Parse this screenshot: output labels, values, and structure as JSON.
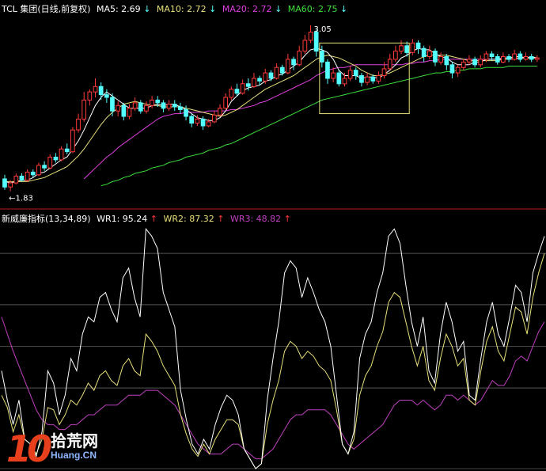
{
  "header_top": {
    "stock": "TCL 集团(日线,前复权)",
    "ma5": "MA5: 2.69",
    "ma10": "MA10: 2.72",
    "ma20": "MA20: 2.72",
    "ma60": "MA60: 2.75",
    "arrow_down": "↓"
  },
  "header_bottom": {
    "indicator": "新威廉指标(13,34,89)",
    "wr1": "WR1: 95.24",
    "wr2": "WR2: 87.32",
    "wr3": "WR3: 48.82",
    "arrow_up": "↑"
  },
  "colors": {
    "up": "#ff3a3a",
    "down": "#54ffff",
    "ma5": "#ffffff",
    "ma10": "#e8e07a",
    "ma20": "#e040e0",
    "ma60": "#3ee03e",
    "box": "#e8e07a",
    "grid": "#8a8a8a",
    "divider": "#b02020",
    "wr1": "#ffffff",
    "wr2": "#e8e07a",
    "wr3": "#c040c0"
  },
  "watermark": {
    "num": "10",
    "cn": "拾荒网",
    "url": "Huang.CN"
  },
  "chart_data": [
    {
      "type": "candlestick",
      "high_label": "3.05",
      "low_label": "1.83",
      "low_arrow": "←",
      "y_range": [
        1.78,
        3.12
      ],
      "candles": [
        [
          1.92,
          1.86,
          1.95,
          1.84
        ],
        [
          1.86,
          1.89,
          1.91,
          1.83
        ],
        [
          1.89,
          1.94,
          1.96,
          1.88
        ],
        [
          1.94,
          1.91,
          1.96,
          1.9
        ],
        [
          1.91,
          1.97,
          1.99,
          1.9
        ],
        [
          1.97,
          1.95,
          1.99,
          1.93
        ],
        [
          1.95,
          2.02,
          2.04,
          1.94
        ],
        [
          2.02,
          2.0,
          2.05,
          1.98
        ],
        [
          2.0,
          2.08,
          2.1,
          1.99
        ],
        [
          2.08,
          2.06,
          2.11,
          2.04
        ],
        [
          2.06,
          2.14,
          2.16,
          2.05
        ],
        [
          2.14,
          2.12,
          2.18,
          2.1
        ],
        [
          2.12,
          2.28,
          2.3,
          2.11
        ],
        [
          2.28,
          2.36,
          2.4,
          2.26
        ],
        [
          2.36,
          2.5,
          2.56,
          2.34
        ],
        [
          2.5,
          2.56,
          2.58,
          2.46
        ],
        [
          2.56,
          2.6,
          2.66,
          2.52
        ],
        [
          2.6,
          2.54,
          2.63,
          2.5
        ],
        [
          2.54,
          2.52,
          2.58,
          2.48
        ],
        [
          2.52,
          2.42,
          2.55,
          2.38
        ],
        [
          2.42,
          2.46,
          2.49,
          2.38
        ],
        [
          2.46,
          2.38,
          2.48,
          2.35
        ],
        [
          2.38,
          2.44,
          2.47,
          2.36
        ],
        [
          2.44,
          2.48,
          2.52,
          2.42
        ],
        [
          2.48,
          2.42,
          2.5,
          2.4
        ],
        [
          2.42,
          2.46,
          2.49,
          2.4
        ],
        [
          2.46,
          2.5,
          2.53,
          2.44
        ],
        [
          2.5,
          2.48,
          2.53,
          2.45
        ],
        [
          2.48,
          2.44,
          2.5,
          2.41
        ],
        [
          2.44,
          2.47,
          2.5,
          2.42
        ],
        [
          2.47,
          2.45,
          2.5,
          2.42
        ],
        [
          2.45,
          2.43,
          2.48,
          2.4
        ],
        [
          2.43,
          2.38,
          2.46,
          2.35
        ],
        [
          2.38,
          2.33,
          2.4,
          2.3
        ],
        [
          2.33,
          2.36,
          2.39,
          2.31
        ],
        [
          2.36,
          2.31,
          2.38,
          2.28
        ],
        [
          2.31,
          2.34,
          2.36,
          2.3
        ],
        [
          2.34,
          2.39,
          2.42,
          2.33
        ],
        [
          2.39,
          2.44,
          2.47,
          2.38
        ],
        [
          2.44,
          2.52,
          2.55,
          2.43
        ],
        [
          2.52,
          2.58,
          2.6,
          2.5
        ],
        [
          2.58,
          2.55,
          2.62,
          2.53
        ],
        [
          2.55,
          2.62,
          2.65,
          2.54
        ],
        [
          2.62,
          2.6,
          2.66,
          2.57
        ],
        [
          2.6,
          2.66,
          2.7,
          2.59
        ],
        [
          2.66,
          2.64,
          2.68,
          2.61
        ],
        [
          2.64,
          2.7,
          2.73,
          2.62
        ],
        [
          2.7,
          2.66,
          2.72,
          2.64
        ],
        [
          2.66,
          2.74,
          2.77,
          2.65
        ],
        [
          2.74,
          2.7,
          2.76,
          2.68
        ],
        [
          2.7,
          2.8,
          2.84,
          2.69
        ],
        [
          2.8,
          2.76,
          2.82,
          2.72
        ],
        [
          2.76,
          2.86,
          2.9,
          2.75
        ],
        [
          2.86,
          2.94,
          2.98,
          2.84
        ],
        [
          2.94,
          3.0,
          3.05,
          2.92
        ],
        [
          3.0,
          2.86,
          3.02,
          2.82
        ],
        [
          2.86,
          2.78,
          2.9,
          2.74
        ],
        [
          2.78,
          2.66,
          2.8,
          2.62
        ],
        [
          2.66,
          2.7,
          2.74,
          2.63
        ],
        [
          2.7,
          2.62,
          2.72,
          2.6
        ],
        [
          2.62,
          2.66,
          2.7,
          2.6
        ],
        [
          2.66,
          2.72,
          2.75,
          2.64
        ],
        [
          2.72,
          2.68,
          2.74,
          2.65
        ],
        [
          2.68,
          2.63,
          2.7,
          2.6
        ],
        [
          2.63,
          2.67,
          2.7,
          2.61
        ],
        [
          2.67,
          2.64,
          2.69,
          2.62
        ],
        [
          2.64,
          2.68,
          2.71,
          2.62
        ],
        [
          2.68,
          2.73,
          2.78,
          2.66
        ],
        [
          2.73,
          2.8,
          2.84,
          2.72
        ],
        [
          2.8,
          2.86,
          2.9,
          2.78
        ],
        [
          2.86,
          2.9,
          2.94,
          2.84
        ],
        [
          2.9,
          2.85,
          2.93,
          2.82
        ],
        [
          2.85,
          2.92,
          2.95,
          2.83
        ],
        [
          2.92,
          2.88,
          2.94,
          2.84
        ],
        [
          2.88,
          2.82,
          2.9,
          2.78
        ],
        [
          2.82,
          2.86,
          2.9,
          2.8
        ],
        [
          2.86,
          2.78,
          2.88,
          2.75
        ],
        [
          2.78,
          2.82,
          2.85,
          2.76
        ],
        [
          2.82,
          2.76,
          2.84,
          2.72
        ],
        [
          2.76,
          2.7,
          2.78,
          2.66
        ],
        [
          2.7,
          2.74,
          2.76,
          2.67
        ],
        [
          2.74,
          2.78,
          2.8,
          2.72
        ],
        [
          2.78,
          2.8,
          2.83,
          2.76
        ],
        [
          2.8,
          2.76,
          2.82,
          2.74
        ],
        [
          2.76,
          2.8,
          2.83,
          2.74
        ],
        [
          2.8,
          2.84,
          2.86,
          2.78
        ],
        [
          2.84,
          2.82,
          2.86,
          2.79
        ],
        [
          2.82,
          2.78,
          2.84,
          2.76
        ],
        [
          2.78,
          2.82,
          2.85,
          2.77
        ],
        [
          2.82,
          2.8,
          2.84,
          2.78
        ],
        [
          2.8,
          2.84,
          2.87,
          2.79
        ],
        [
          2.84,
          2.8,
          2.86,
          2.78
        ],
        [
          2.8,
          2.82,
          2.85,
          2.79
        ],
        [
          2.82,
          2.8,
          2.84,
          2.78
        ],
        [
          2.8,
          2.81,
          2.83,
          2.78
        ]
      ],
      "ma5": [
        1.9,
        1.89,
        1.9,
        1.91,
        1.91,
        1.93,
        1.96,
        1.97,
        2.0,
        2.03,
        2.06,
        2.08,
        2.14,
        2.2,
        2.28,
        2.37,
        2.46,
        2.52,
        2.56,
        2.53,
        2.5,
        2.47,
        2.44,
        2.44,
        2.44,
        2.44,
        2.46,
        2.47,
        2.46,
        2.47,
        2.47,
        2.45,
        2.43,
        2.4,
        2.37,
        2.36,
        2.35,
        2.35,
        2.37,
        2.42,
        2.49,
        2.53,
        2.57,
        2.59,
        2.6,
        2.61,
        2.64,
        2.65,
        2.68,
        2.69,
        2.72,
        2.75,
        2.78,
        2.83,
        2.87,
        2.88,
        2.87,
        2.85,
        2.8,
        2.72,
        2.68,
        2.68,
        2.68,
        2.66,
        2.67,
        2.67,
        2.66,
        2.69,
        2.72,
        2.76,
        2.81,
        2.83,
        2.86,
        2.88,
        2.87,
        2.87,
        2.84,
        2.82,
        2.81,
        2.78,
        2.76,
        2.76,
        2.76,
        2.78,
        2.78,
        2.8,
        2.8,
        2.8,
        2.81,
        2.81,
        2.82,
        2.82,
        2.81,
        2.82,
        2.81
      ],
      "ma10": [
        1.9,
        1.9,
        1.9,
        1.9,
        1.9,
        1.91,
        1.92,
        1.93,
        1.95,
        1.97,
        1.99,
        2.01,
        2.05,
        2.09,
        2.14,
        2.2,
        2.26,
        2.32,
        2.37,
        2.41,
        2.44,
        2.47,
        2.48,
        2.49,
        2.48,
        2.47,
        2.46,
        2.46,
        2.45,
        2.45,
        2.45,
        2.45,
        2.44,
        2.43,
        2.42,
        2.41,
        2.4,
        2.39,
        2.38,
        2.39,
        2.41,
        2.43,
        2.46,
        2.49,
        2.52,
        2.55,
        2.58,
        2.6,
        2.62,
        2.64,
        2.66,
        2.68,
        2.71,
        2.74,
        2.77,
        2.8,
        2.82,
        2.83,
        2.82,
        2.81,
        2.79,
        2.77,
        2.75,
        2.72,
        2.7,
        2.68,
        2.68,
        2.69,
        2.7,
        2.72,
        2.74,
        2.76,
        2.78,
        2.8,
        2.82,
        2.83,
        2.83,
        2.83,
        2.83,
        2.82,
        2.81,
        2.8,
        2.79,
        2.79,
        2.79,
        2.79,
        2.79,
        2.79,
        2.8,
        2.8,
        2.81,
        2.81,
        2.81,
        2.81,
        2.81
      ],
      "ma20": [
        null,
        null,
        null,
        null,
        null,
        null,
        null,
        null,
        null,
        null,
        null,
        null,
        null,
        null,
        1.92,
        1.96,
        2.0,
        2.04,
        2.08,
        2.11,
        2.15,
        2.18,
        2.21,
        2.24,
        2.27,
        2.3,
        2.33,
        2.36,
        2.38,
        2.39,
        2.4,
        2.4,
        2.41,
        2.41,
        2.41,
        2.41,
        2.42,
        2.42,
        2.42,
        2.42,
        2.43,
        2.43,
        2.44,
        2.45,
        2.46,
        2.48,
        2.49,
        2.51,
        2.53,
        2.55,
        2.57,
        2.59,
        2.61,
        2.63,
        2.65,
        2.68,
        2.7,
        2.72,
        2.73,
        2.74,
        2.74,
        2.75,
        2.76,
        2.76,
        2.76,
        2.76,
        2.76,
        2.76,
        2.76,
        2.76,
        2.76,
        2.77,
        2.77,
        2.78,
        2.78,
        2.79,
        2.79,
        2.8,
        2.8,
        2.8,
        2.8,
        2.8,
        2.8,
        2.8,
        2.8,
        2.8,
        2.8,
        2.8,
        2.8,
        2.8,
        2.8,
        2.81,
        2.81,
        2.81,
        2.81
      ],
      "ma60": [
        null,
        null,
        null,
        null,
        null,
        null,
        null,
        null,
        null,
        null,
        null,
        null,
        null,
        null,
        null,
        null,
        null,
        1.87,
        1.88,
        1.9,
        1.91,
        1.93,
        1.94,
        1.96,
        1.97,
        1.98,
        2.0,
        2.01,
        2.02,
        2.04,
        2.05,
        2.06,
        2.08,
        2.09,
        2.1,
        2.11,
        2.13,
        2.14,
        2.15,
        2.17,
        2.18,
        2.2,
        2.22,
        2.24,
        2.26,
        2.28,
        2.3,
        2.32,
        2.34,
        2.36,
        2.38,
        2.4,
        2.42,
        2.44,
        2.46,
        2.48,
        2.5,
        2.51,
        2.52,
        2.53,
        2.54,
        2.55,
        2.56,
        2.57,
        2.58,
        2.59,
        2.6,
        2.61,
        2.62,
        2.63,
        2.64,
        2.65,
        2.66,
        2.67,
        2.68,
        2.69,
        2.7,
        2.7,
        2.71,
        2.71,
        2.72,
        2.72,
        2.73,
        2.73,
        2.73,
        2.74,
        2.74,
        2.74,
        2.74,
        2.75,
        2.75,
        2.75,
        2.75,
        2.75,
        2.75
      ]
    },
    {
      "type": "line",
      "y_range": [
        0,
        100
      ],
      "gridlines": [
        0,
        33,
        50,
        67,
        88
      ],
      "series": [
        {
          "name": "WR1",
          "values": [
            40,
            28,
            18,
            28,
            12,
            10,
            5,
            15,
            40,
            35,
            22,
            30,
            45,
            40,
            55,
            62,
            60,
            70,
            72,
            65,
            60,
            78,
            82,
            70,
            62,
            98,
            95,
            90,
            72,
            65,
            58,
            32,
            20,
            10,
            6,
            12,
            8,
            18,
            25,
            30,
            28,
            22,
            8,
            4,
            0,
            2,
            28,
            45,
            60,
            80,
            85,
            82,
            70,
            78,
            72,
            65,
            60,
            50,
            30,
            10,
            6,
            15,
            45,
            55,
            60,
            72,
            80,
            95,
            98,
            92,
            75,
            60,
            50,
            62,
            40,
            35,
            55,
            68,
            60,
            48,
            52,
            30,
            28,
            45,
            60,
            68,
            55,
            50,
            62,
            75,
            72,
            60,
            80,
            88,
            95
          ]
        },
        {
          "name": "WR2",
          "values": [
            30,
            25,
            15,
            22,
            12,
            10,
            6,
            12,
            25,
            24,
            18,
            22,
            28,
            26,
            30,
            35,
            32,
            38,
            40,
            36,
            34,
            42,
            45,
            40,
            38,
            55,
            52,
            48,
            42,
            38,
            34,
            22,
            14,
            8,
            5,
            10,
            6,
            12,
            16,
            20,
            20,
            18,
            8,
            4,
            0,
            2,
            18,
            28,
            36,
            48,
            52,
            50,
            45,
            48,
            46,
            42,
            40,
            36,
            24,
            10,
            6,
            12,
            30,
            38,
            42,
            50,
            56,
            68,
            72,
            70,
            60,
            50,
            42,
            50,
            36,
            32,
            45,
            55,
            50,
            42,
            45,
            28,
            26,
            40,
            52,
            58,
            48,
            44,
            55,
            66,
            64,
            55,
            70,
            80,
            88
          ]
        },
        {
          "name": "WR3",
          "values": [
            62,
            55,
            48,
            42,
            36,
            30,
            24,
            20,
            18,
            18,
            16,
            16,
            18,
            18,
            20,
            22,
            22,
            24,
            26,
            26,
            26,
            28,
            30,
            30,
            30,
            32,
            32,
            32,
            30,
            28,
            26,
            22,
            18,
            14,
            10,
            8,
            6,
            6,
            6,
            8,
            10,
            10,
            8,
            6,
            4,
            4,
            6,
            8,
            12,
            16,
            20,
            22,
            22,
            24,
            24,
            24,
            24,
            22,
            18,
            14,
            10,
            8,
            10,
            12,
            14,
            16,
            18,
            22,
            26,
            28,
            28,
            28,
            26,
            28,
            26,
            24,
            26,
            30,
            30,
            28,
            30,
            28,
            26,
            28,
            32,
            36,
            34,
            34,
            38,
            44,
            46,
            44,
            50,
            56,
            60
          ]
        }
      ]
    }
  ]
}
